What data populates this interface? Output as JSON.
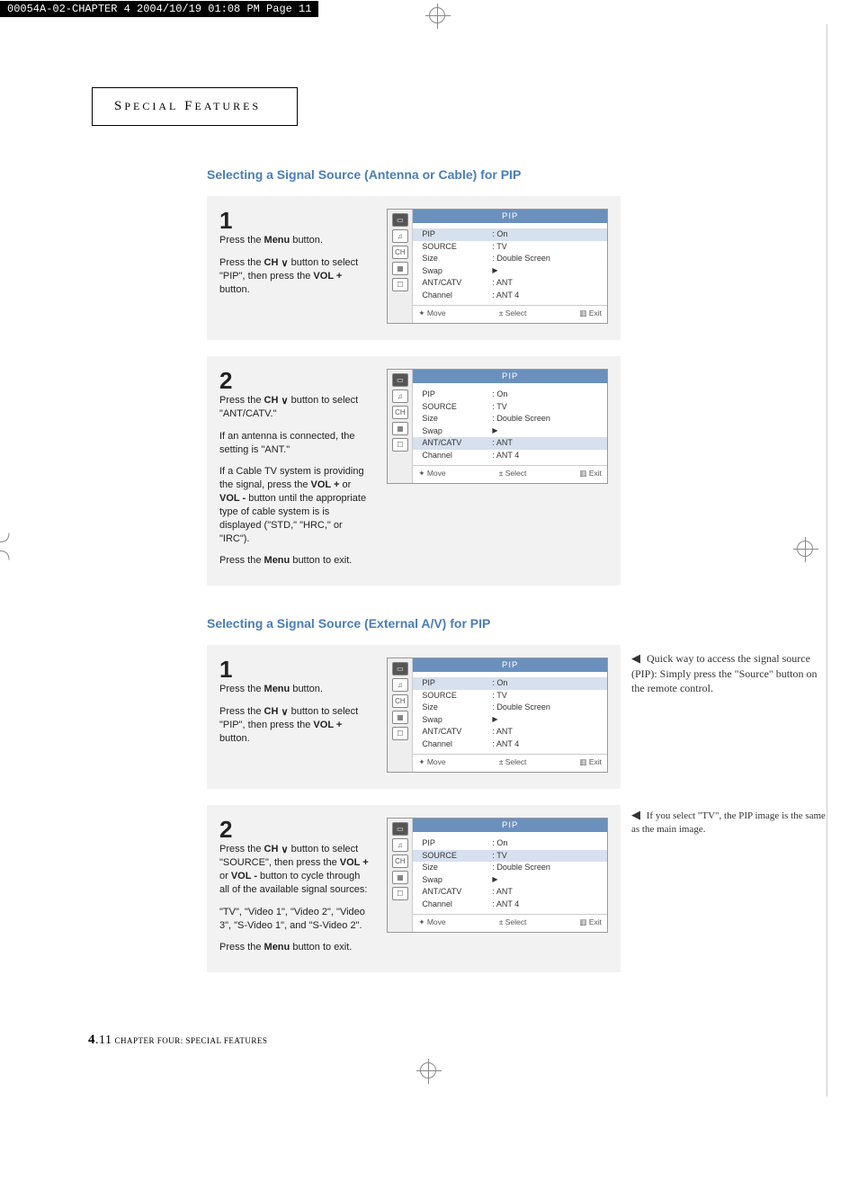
{
  "header_strip": "00054A-02-CHAPTER 4  2004/10/19  01:08 PM  Page 11",
  "title_box": "SPECIAL FEATURES",
  "heading1": "Selecting a Signal Source (Antenna or Cable) for PIP",
  "heading2": "Selecting a Signal Source (External A/V) for PIP",
  "step1": {
    "num": "1",
    "p1_a": "Press the ",
    "p1_b": "Menu",
    "p1_c": " button.",
    "p2_a": "Press the ",
    "p2_b": "CH ",
    "p2_c": " button to select \"PIP\", then press the ",
    "p2_d": "VOL +",
    "p2_e": " button."
  },
  "step2": {
    "num": "2",
    "p1_a": "Press the ",
    "p1_b": "CH ",
    "p1_c": " button to select \"ANT/CATV.\"",
    "p2": "If an antenna is connected, the setting is \"ANT.\"",
    "p3_a": "If a Cable TV system is providing the signal, press the ",
    "p3_b": "VOL +",
    "p3_c": " or ",
    "p3_d": "VOL -",
    "p3_e": " button until the appropriate type of cable system is is displayed (\"STD,\" \"HRC,\" or \"IRC\").",
    "p4_a": "Press the ",
    "p4_b": "Menu",
    "p4_c": " button to exit."
  },
  "stepB1": {
    "num": "1",
    "p1_a": "Press the ",
    "p1_b": "Menu",
    "p1_c": " button.",
    "p2_a": "Press the ",
    "p2_b": "CH ",
    "p2_c": " button to select \"PIP\", then press the ",
    "p2_d": "VOL +",
    "p2_e": " button."
  },
  "stepB2": {
    "num": "2",
    "p1_a": "Press the ",
    "p1_b": "CH ",
    "p1_c": " button to select \"SOURCE\", then press the ",
    "p1_d": "VOL +",
    "p1_e": " or ",
    "p1_f": "VOL -",
    "p1_g": " button to cycle through all of the available signal sources:",
    "p2": "\"TV\", \"Video 1\", \"Video 2\", \"Video 3\", \"S-Video 1\", and \"S-Video 2\".",
    "p3_a": "Press the ",
    "p3_b": "Menu",
    "p3_c": " button to exit."
  },
  "osd": {
    "title": "PIP",
    "rows": {
      "pip_l": "PIP",
      "pip_v": ": On",
      "src_l": "SOURCE",
      "src_v": ": TV",
      "size_l": "Size",
      "size_v": ": Double Screen",
      "swap_l": "Swap",
      "swap_v": "▶",
      "ant_l": "ANT/CATV",
      "ant_v": ": ANT",
      "ch_l": "Channel",
      "ch_v": ": ANT 4"
    },
    "foot_move": "✦ Move",
    "foot_select": "± Select",
    "foot_exit": "▥ Exit"
  },
  "note1": "Quick way to access the signal source (PIP): Simply press the \"Source\" button on the remote control.",
  "note2": "If you select \"TV\", the PIP image is the same as the main image.",
  "footer": {
    "pgnum_bold": "4",
    "pgnum_rest": ".11",
    "chapter": " CHAPTER FOUR: SPECIAL FEATURES"
  }
}
